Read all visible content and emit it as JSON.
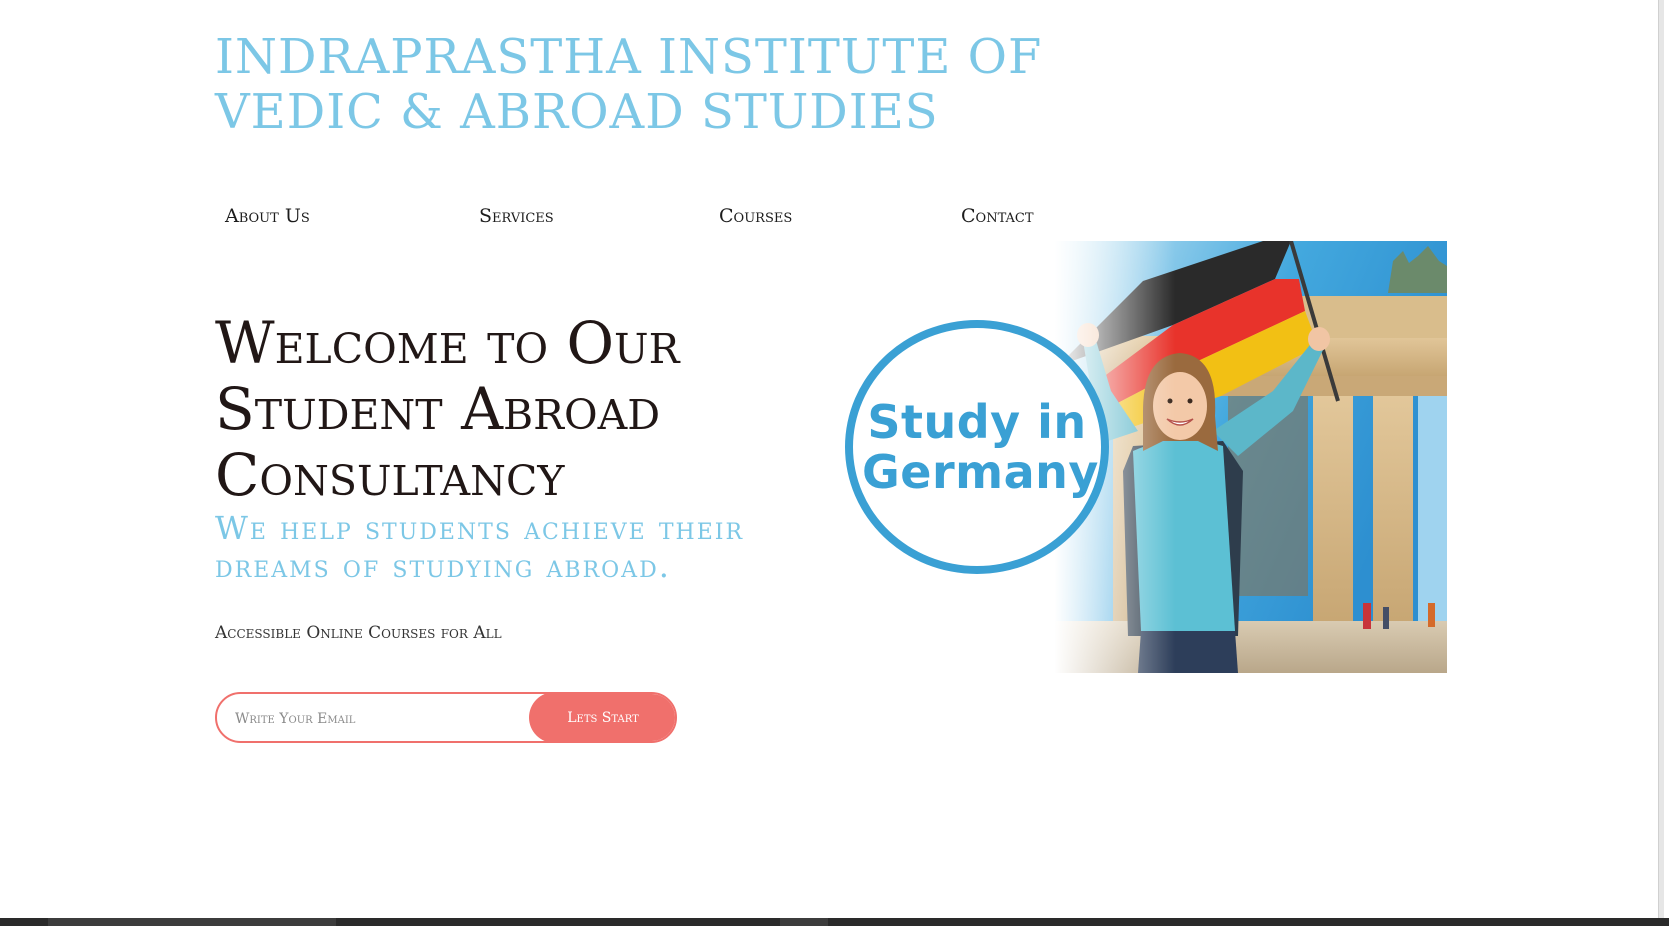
{
  "site": {
    "title": "INDRAPRASTHA INSTITUTE OF VEDIC & ABROAD STUDIES"
  },
  "nav": {
    "items": [
      {
        "label": "About Us"
      },
      {
        "label": "Services"
      },
      {
        "label": "Courses"
      },
      {
        "label": "Contact"
      }
    ]
  },
  "hero": {
    "heading": "Welcome to Our Student Abroad Consultancy",
    "subheading": "We help students achieve their dreams of studying abroad.",
    "tagline": "Accessible Online Courses for All",
    "image_badge": "Study in Germany"
  },
  "signup": {
    "email_placeholder": "Write Your Email",
    "email_value": "",
    "button_label": "Lets Start"
  },
  "colors": {
    "accent_blue": "#7cc7e6",
    "badge_blue": "#3aa0d4",
    "coral": "#f0706c",
    "heading_dark": "#211716"
  }
}
